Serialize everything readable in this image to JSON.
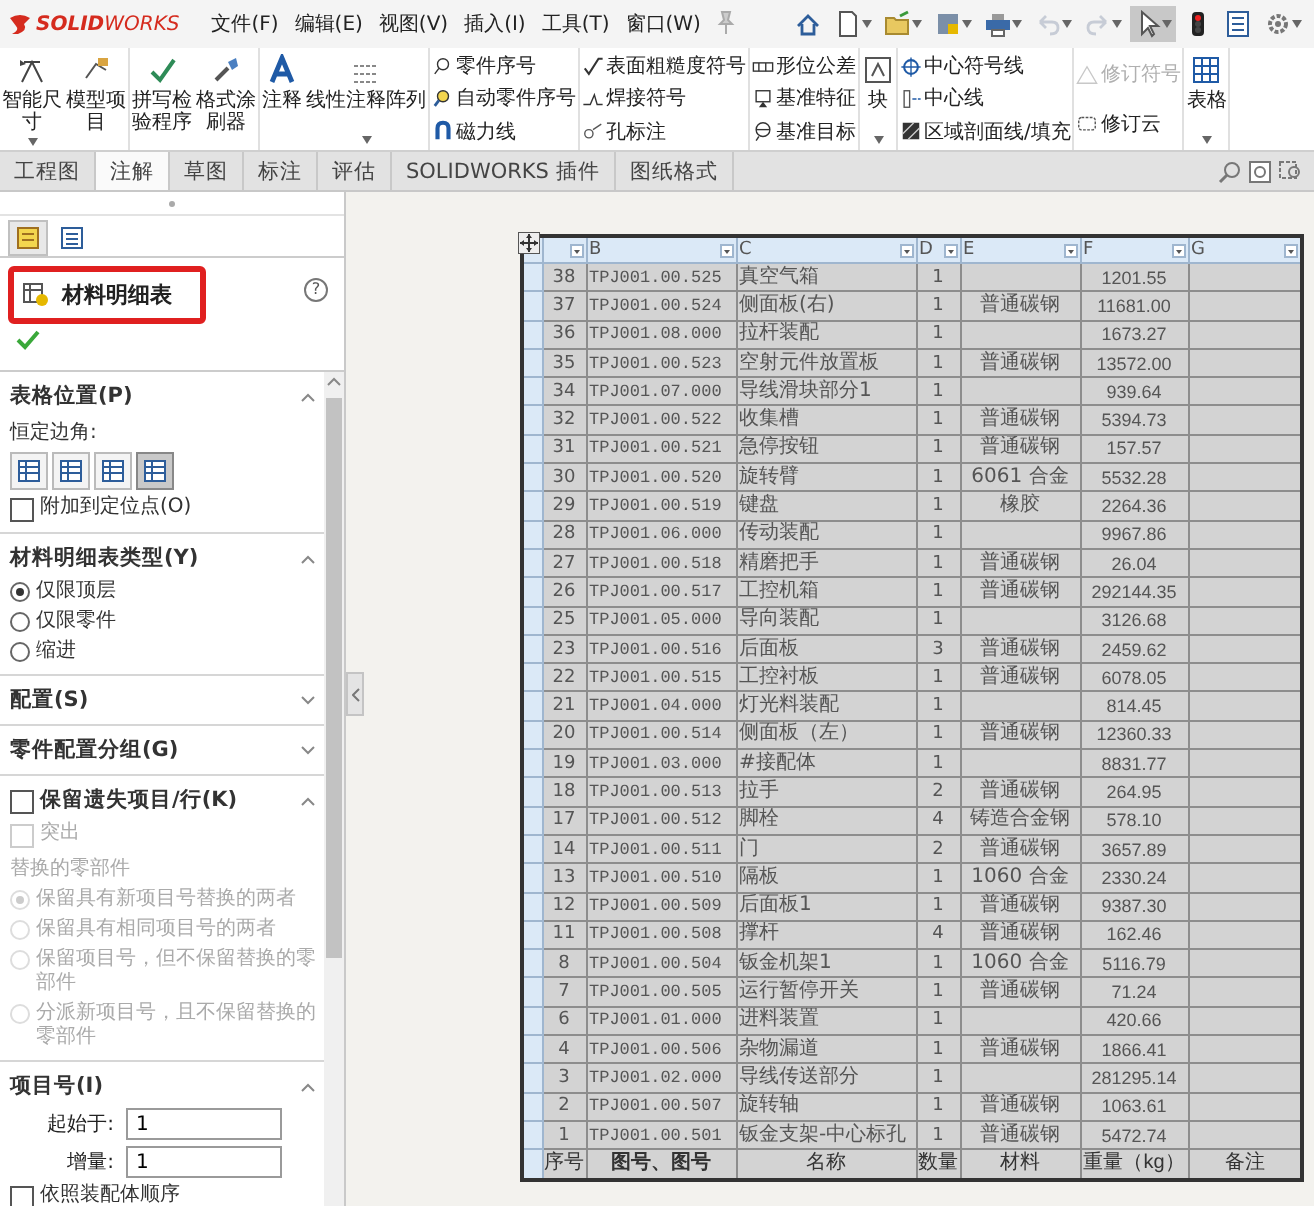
{
  "app": {
    "logo": "**SOLID**WORKS",
    "menus": [
      "文件(F)",
      "编辑(E)",
      "视图(V)",
      "插入(I)",
      "工具(T)",
      "窗口(W)"
    ]
  },
  "ribbon": {
    "groups": [
      {
        "kind": "large",
        "items": [
          {
            "label": "智能尺寸",
            "dropdown": true
          },
          {
            "label": "模型项目",
            "dropdown": false
          }
        ]
      },
      {
        "kind": "large",
        "items": [
          {
            "label": "拼写检验程序",
            "dropdown": false
          },
          {
            "label": "格式涂刷器",
            "dropdown": false
          }
        ]
      },
      {
        "kind": "large-wide",
        "items": [
          {
            "label": "注释",
            "dropdown": false
          },
          {
            "label": "线性注释阵列",
            "dropdown": true
          }
        ]
      },
      {
        "kind": "small",
        "items": [
          {
            "label": "零件序号",
            "disabled": false
          },
          {
            "label": "自动零件序号",
            "disabled": false
          },
          {
            "label": "磁力线",
            "disabled": false
          }
        ]
      },
      {
        "kind": "small",
        "items": [
          {
            "label": "表面粗糙度符号",
            "disabled": false
          },
          {
            "label": "焊接符号",
            "disabled": false
          },
          {
            "label": "孔标注",
            "disabled": false
          }
        ]
      },
      {
        "kind": "small",
        "items": [
          {
            "label": "形位公差",
            "disabled": false
          },
          {
            "label": "基准特征",
            "disabled": false
          },
          {
            "label": "基准目标",
            "disabled": false
          }
        ]
      },
      {
        "kind": "large",
        "items": [
          {
            "label": "块",
            "dropdown": true
          }
        ]
      },
      {
        "kind": "small",
        "items": [
          {
            "label": "中心符号线",
            "disabled": false
          },
          {
            "label": "中心线",
            "disabled": false
          },
          {
            "label": "区域剖面线/填充",
            "disabled": false
          }
        ]
      },
      {
        "kind": "small",
        "items": [
          {
            "label": "修订符号",
            "disabled": true
          },
          {
            "label": "修订云",
            "disabled": false
          }
        ]
      },
      {
        "kind": "large",
        "items": [
          {
            "label": "表格",
            "dropdown": true
          }
        ]
      }
    ]
  },
  "tabs": [
    {
      "label": "工程图",
      "selected": false
    },
    {
      "label": "注解",
      "selected": true
    },
    {
      "label": "草图",
      "selected": false
    },
    {
      "label": "标注",
      "selected": false
    },
    {
      "label": "评估",
      "selected": false
    },
    {
      "label": "SOLIDWORKS 插件",
      "selected": false
    },
    {
      "label": "图纸格式",
      "selected": false
    }
  ],
  "property_manager": {
    "title": "材料明细表",
    "help": "?",
    "sections": [
      {
        "title": "表格位置(P)",
        "expanded": true,
        "items": [
          {
            "kind": "label",
            "text": "恒定边角:"
          },
          {
            "kind": "corners",
            "options": [
              {
                "selected": false
              },
              {
                "selected": false
              },
              {
                "selected": false
              },
              {
                "selected": true
              }
            ]
          },
          {
            "kind": "checkbox",
            "label": "附加到定位点(O)",
            "checked": false,
            "disabled": false
          }
        ]
      },
      {
        "title": "材料明细表类型(Y)",
        "expanded": true,
        "items": [
          {
            "kind": "radio",
            "label": "仅限顶层",
            "selected": true,
            "disabled": false
          },
          {
            "kind": "radio",
            "label": "仅限零件",
            "selected": false,
            "disabled": false
          },
          {
            "kind": "radio",
            "label": "缩进",
            "selected": false,
            "disabled": false
          }
        ]
      },
      {
        "title": "配置(S)",
        "expanded": false
      },
      {
        "title": "零件配置分组(G)",
        "expanded": false
      },
      {
        "title": "保留遗失项目/行(K)",
        "expanded": true,
        "checked": false,
        "items": [
          {
            "kind": "checkbox",
            "label": "突出",
            "checked": false,
            "disabled": true
          },
          {
            "kind": "label",
            "text": "替换的零部件",
            "disabled": true
          },
          {
            "kind": "radio",
            "label": "保留具有新项目号替换的两者",
            "selected": true,
            "disabled": true
          },
          {
            "kind": "radio",
            "label": "保留具有相同项目号的两者",
            "selected": false,
            "disabled": true
          },
          {
            "kind": "radio",
            "label": "保留项目号，但不保留替换的零部件",
            "selected": false,
            "disabled": true
          },
          {
            "kind": "radio",
            "label": "分派新项目号，且不保留替换的零部件",
            "selected": false,
            "disabled": true
          }
        ]
      },
      {
        "title": "项目号(I)",
        "expanded": true,
        "items": [
          {
            "kind": "field",
            "label": "起始于:",
            "value": "1"
          },
          {
            "kind": "field",
            "label": "增量:",
            "value": "1"
          },
          {
            "kind": "checkbox",
            "label": "依照装配体顺序",
            "checked": false,
            "disabled": false
          }
        ]
      }
    ]
  },
  "bom": {
    "columns": [
      "",
      "B",
      "C",
      "D",
      "E",
      "F",
      "G"
    ],
    "rows": [
      [
        "38",
        "TPJ001.00.525",
        "真空气箱",
        "1",
        "",
        "1201.55",
        ""
      ],
      [
        "37",
        "TPJ001.00.524",
        "侧面板(右)",
        "1",
        "普通碳钢",
        "11681.00",
        ""
      ],
      [
        "36",
        "TPJ001.08.000",
        "拉杆装配",
        "1",
        "",
        "1673.27",
        ""
      ],
      [
        "35",
        "TPJ001.00.523",
        "空射元件放置板",
        "1",
        "普通碳钢",
        "13572.00",
        ""
      ],
      [
        "34",
        "TPJ001.07.000",
        "导线滑块部分1",
        "1",
        "",
        "939.64",
        ""
      ],
      [
        "32",
        "TPJ001.00.522",
        "收集槽",
        "1",
        "普通碳钢",
        "5394.73",
        ""
      ],
      [
        "31",
        "TPJ001.00.521",
        "急停按钮",
        "1",
        "普通碳钢",
        "157.57",
        ""
      ],
      [
        "30",
        "TPJ001.00.520",
        "旋转臂",
        "1",
        "6061 合金",
        "5532.28",
        ""
      ],
      [
        "29",
        "TPJ001.00.519",
        "键盘",
        "1",
        "橡胶",
        "2264.36",
        ""
      ],
      [
        "28",
        "TPJ001.06.000",
        "传动装配",
        "1",
        "",
        "9967.86",
        ""
      ],
      [
        "27",
        "TPJ001.00.518",
        "精磨把手",
        "1",
        "普通碳钢",
        "26.04",
        ""
      ],
      [
        "26",
        "TPJ001.00.517",
        "工控机箱",
        "1",
        "普通碳钢",
        "292144.35",
        ""
      ],
      [
        "25",
        "TPJ001.05.000",
        "导向装配",
        "1",
        "",
        "3126.68",
        ""
      ],
      [
        "23",
        "TPJ001.00.516",
        "后面板",
        "3",
        "普通碳钢",
        "2459.62",
        ""
      ],
      [
        "22",
        "TPJ001.00.515",
        "工控衬板",
        "1",
        "普通碳钢",
        "6078.05",
        ""
      ],
      [
        "21",
        "TPJ001.04.000",
        "灯光料装配",
        "1",
        "",
        "814.45",
        ""
      ],
      [
        "20",
        "TPJ001.00.514",
        "侧面板（左）",
        "1",
        "普通碳钢",
        "12360.33",
        ""
      ],
      [
        "19",
        "TPJ001.03.000",
        "#接配体",
        "1",
        "",
        "8831.77",
        ""
      ],
      [
        "18",
        "TPJ001.00.513",
        "拉手",
        "2",
        "普通碳钢",
        "264.95",
        ""
      ],
      [
        "17",
        "TPJ001.00.512",
        "脚栓",
        "4",
        "铸造合金钢",
        "578.10",
        ""
      ],
      [
        "14",
        "TPJ001.00.511",
        "门",
        "2",
        "普通碳钢",
        "3657.89",
        ""
      ],
      [
        "13",
        "TPJ001.00.510",
        "隔板",
        "1",
        "1060 合金",
        "2330.24",
        ""
      ],
      [
        "12",
        "TPJ001.00.509",
        "后面板1",
        "1",
        "普通碳钢",
        "9387.30",
        ""
      ],
      [
        "11",
        "TPJ001.00.508",
        "撑杆",
        "4",
        "普通碳钢",
        "162.46",
        ""
      ],
      [
        "8",
        "TPJ001.00.504",
        "钣金机架1",
        "1",
        "1060 合金",
        "5116.79",
        ""
      ],
      [
        "7",
        "TPJ001.00.505",
        "运行暂停开关",
        "1",
        "普通碳钢",
        "71.24",
        ""
      ],
      [
        "6",
        "TPJ001.01.000",
        "进料装置",
        "1",
        "",
        "420.66",
        ""
      ],
      [
        "4",
        "TPJ001.00.506",
        "杂物漏道",
        "1",
        "普通碳钢",
        "1866.41",
        ""
      ],
      [
        "3",
        "TPJ001.02.000",
        "导线传送部分",
        "1",
        "",
        "281295.14",
        ""
      ],
      [
        "2",
        "TPJ001.00.507",
        "旋转轴",
        "1",
        "普通碳钢",
        "1063.61",
        ""
      ],
      [
        "1",
        "TPJ001.00.501",
        "钣金支架-中心标孔",
        "1",
        "普通碳钢",
        "5472.74",
        ""
      ]
    ],
    "footer": [
      "序号",
      "图号、图号",
      "名称",
      "数量",
      "材料",
      "重量（kg）",
      "备注"
    ]
  }
}
